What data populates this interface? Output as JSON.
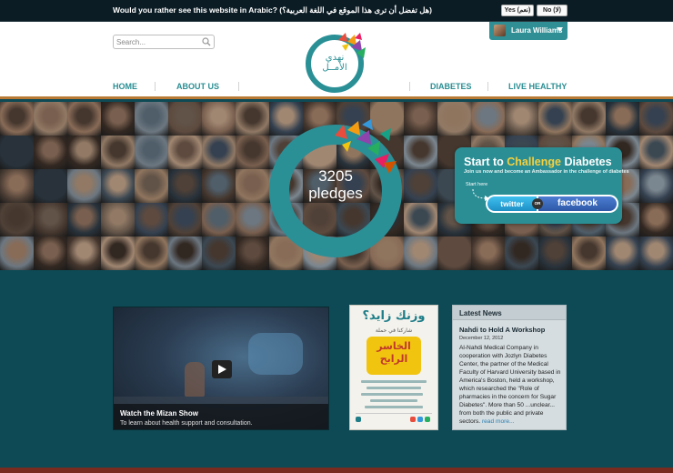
{
  "lang_bar": {
    "question": "Would you rather see this website in Arabic? (هل تفضل أن ترى هذا الموقع في اللغة العربية؟)",
    "yes_label": "Yes (نعم)",
    "no_label": "No (لا)"
  },
  "header": {
    "search_placeholder": "Search...",
    "user_name": "Laura Williams",
    "logo_line1": "نهدي",
    "logo_line2": "الأمــل",
    "nav": {
      "home": "HOME",
      "about": "ABOUT US",
      "diabetes": "DIABETES",
      "live_healthy": "LIVE HEALTHY"
    }
  },
  "hero": {
    "pledge_count": "3205",
    "pledge_unit": "pledges",
    "cta": {
      "title_start": "Start to ",
      "title_highlight": "Challenge",
      "title_end": " Diabetes",
      "subtitle": "Join us now and become an Ambassador in the challenge of diabetes",
      "start_here": "Start here",
      "twitter": "twitter",
      "or": "OR",
      "facebook": "facebook"
    },
    "accent_color": "#2b8f96"
  },
  "video": {
    "title": "Watch the Mizan Show",
    "subtitle": "To learn about health support and consultation."
  },
  "poster": {
    "title": "وزنك زايد؟",
    "subtitle": "شاركنا في حملة",
    "badge_line1": "الخاسر",
    "badge_line2": "الرابح"
  },
  "news": {
    "header": "Latest News",
    "title": "Nahdi to Hold A Workshop",
    "date": "December 12, 2012",
    "body": "Al-Nahdi Medical Company in cooperation with Jozlyn Diabetes Center, the partner of the Medical Faculty of Harvard University based in America's Boston, held a workshop, which researched the \"Role of pharmacies in the concern for Sugar Diabetes\". More than 50 ...unclear... from both the public and private sectors.",
    "read_more": "read more..."
  }
}
